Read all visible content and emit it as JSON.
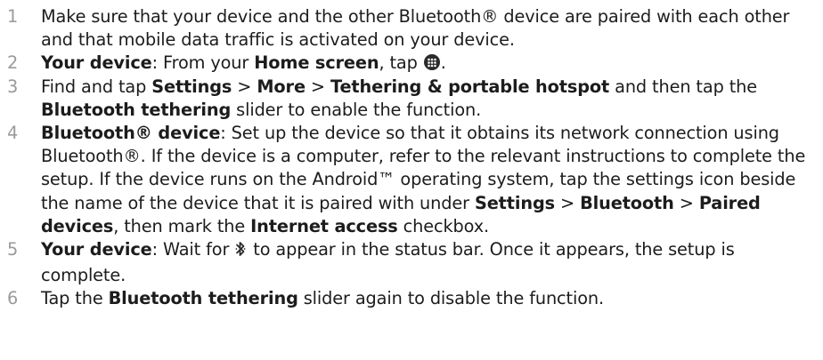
{
  "steps": [
    {
      "number": "1",
      "text": "Make sure that your device and the other Bluetooth® device are paired with each other and that mobile data traffic is activated on your device."
    },
    {
      "number": "2",
      "lead": "Your device",
      "t1": ": From your ",
      "b1": "Home screen",
      "t2": ", tap ",
      "t3": ".",
      "icon": "apps-grid-icon"
    },
    {
      "number": "3",
      "t1": "Find and tap ",
      "b1": "Settings",
      "sep1": " > ",
      "b2": "More",
      "sep2": " > ",
      "b3": "Tethering & portable hotspot",
      "t2": " and then tap the ",
      "b4": "Bluetooth tethering",
      "t3": " slider to enable the function."
    },
    {
      "number": "4",
      "lead": "Bluetooth® device",
      "t1": ": Set up the device so that it obtains its network connection using Bluetooth®. If the device is a computer, refer to the relevant instructions to complete the setup. If the device runs on the Android™ operating system, tap the settings icon beside the name of the device that it is paired with under ",
      "b1": "Settings",
      "sep1": " > ",
      "b2": "Bluetooth",
      "sep2": " > ",
      "b3": "Paired devices",
      "t2": ", then mark the ",
      "b4": "Internet access",
      "t3": " checkbox."
    },
    {
      "number": "5",
      "lead": "Your device",
      "t1": ": Wait for ",
      "t2": " to appear in the status bar. Once it appears, the setup is complete.",
      "icon": "bluetooth-icon"
    },
    {
      "number": "6",
      "t1": "Tap the ",
      "b1": "Bluetooth tethering",
      "t2": " slider again to disable the function."
    }
  ]
}
